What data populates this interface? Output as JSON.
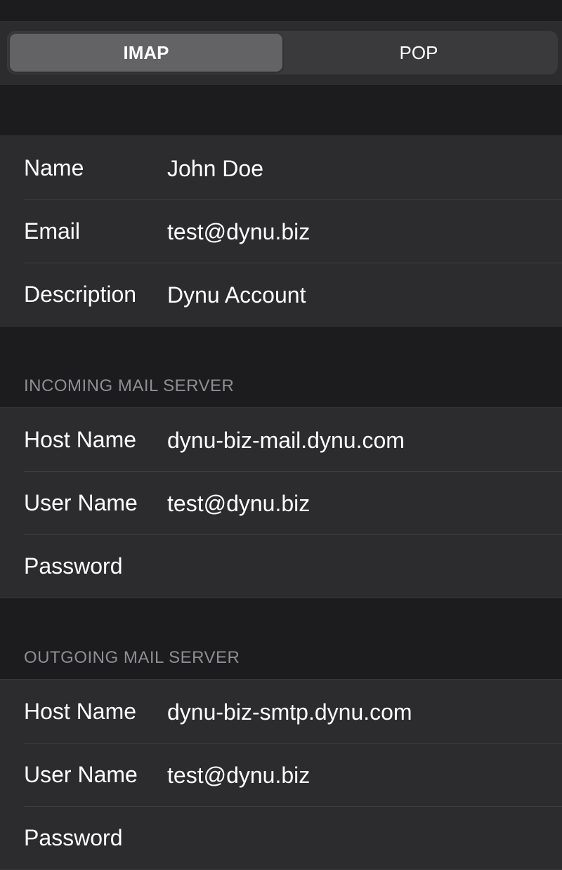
{
  "segmented_control": {
    "options": [
      {
        "label": "IMAP",
        "selected": true
      },
      {
        "label": "POP",
        "selected": false
      }
    ]
  },
  "account": {
    "rows": [
      {
        "label": "Name",
        "value": "John Doe"
      },
      {
        "label": "Email",
        "value": "test@dynu.biz"
      },
      {
        "label": "Description",
        "value": "Dynu Account"
      }
    ]
  },
  "incoming": {
    "header": "INCOMING MAIL SERVER",
    "rows": [
      {
        "label": "Host Name",
        "value": "dynu-biz-mail.dynu.com"
      },
      {
        "label": "User Name",
        "value": "test@dynu.biz"
      },
      {
        "label": "Password",
        "value": ""
      }
    ]
  },
  "outgoing": {
    "header": "OUTGOING MAIL SERVER",
    "rows": [
      {
        "label": "Host Name",
        "value": "dynu-biz-smtp.dynu.com"
      },
      {
        "label": "User Name",
        "value": "test@dynu.biz"
      },
      {
        "label": "Password",
        "value": ""
      }
    ]
  },
  "colors": {
    "background": "#1c1c1e",
    "cell": "#2c2c2e",
    "segment_track": "#3a3a3c",
    "segment_selected": "#636366",
    "secondary_text": "#8e8e93"
  }
}
